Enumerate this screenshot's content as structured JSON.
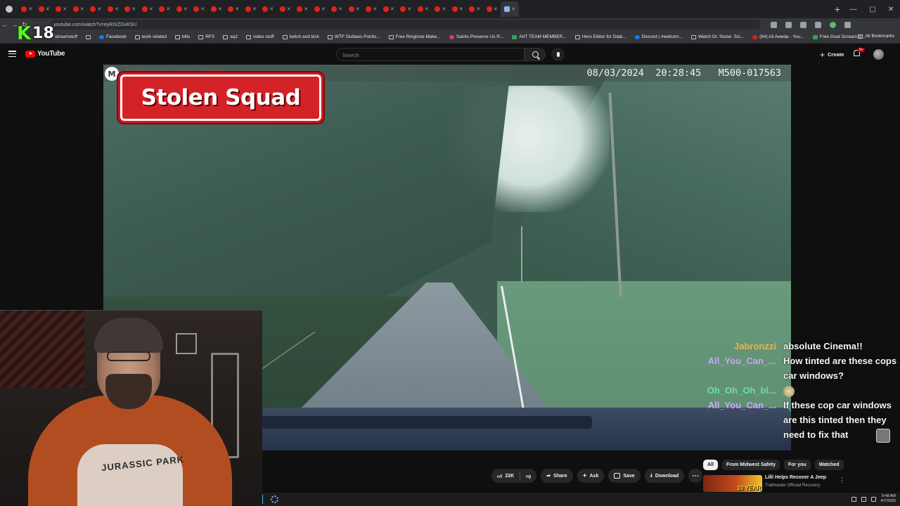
{
  "overlay": {
    "k_logo": "K",
    "k_count": "18"
  },
  "browser": {
    "tab_count": 29,
    "address": "youtube.com/watch?v=eyRIXZGvKSU",
    "bookmarks": [
      {
        "label": "Facebook",
        "icon": "facebook-icon"
      },
      {
        "label": "work related",
        "icon": "folder-icon"
      },
      {
        "label": "bills",
        "icon": "folder-icon"
      },
      {
        "label": "RFS",
        "icon": "folder-icon"
      },
      {
        "label": "eq2",
        "icon": "folder-icon"
      },
      {
        "label": "video stuff",
        "icon": "folder-icon"
      },
      {
        "label": "twitch and kick",
        "icon": "folder-icon"
      },
      {
        "label": "WTF Outlaws Points...",
        "icon": "folder-icon"
      },
      {
        "label": "Free Ringtone Make...",
        "icon": "page-icon"
      },
      {
        "label": "Saints Preserve Us R...",
        "icon": "pink-icon"
      },
      {
        "label": "AIIT TEAM MEMBER...",
        "icon": "green-icon"
      },
      {
        "label": "Hero Editor for Diab...",
        "icon": "page-icon"
      },
      {
        "label": "Discord | #welcom...",
        "icon": "discord-icon"
      },
      {
        "label": "Watch Dr. Stone: Sci...",
        "icon": "globe-icon"
      },
      {
        "label": "(84) Ali Aweda - You...",
        "icon": "youtube-icon"
      },
      {
        "label": "Free Goat Scream S...",
        "icon": "green-icon"
      }
    ],
    "all_bookmarks": "All Bookmarks",
    "partial_bookmark": "streamstuff"
  },
  "youtube": {
    "logo_text": "YouTube",
    "search_placeholder": "Search",
    "create_label": "Create",
    "notification_badge": "9+"
  },
  "video": {
    "watermark": "MOTOROLA SOLUTIONS",
    "timestamp": "08/03/2024  20:28:45   M500-017563",
    "title_overlay": "Stolen Squad"
  },
  "webcam": {
    "shirt_text": "JURASSIC PARK"
  },
  "chat": [
    {
      "user": "Jabronzzi",
      "color": "#e8b450",
      "text": "absolute Cinema!!"
    },
    {
      "user": "All_You_Can_...",
      "color": "#c9a5ff",
      "text": "How tinted are these cops car windows?"
    },
    {
      "user": "Oh_Oh_Oh_bl...",
      "color": "#6be0a0",
      "text": "",
      "emote": true
    },
    {
      "user": "All_You_Can_...",
      "color": "#c9a5ff",
      "text": "If these cop car windows are this tinted then they need to fix that"
    }
  ],
  "actions": {
    "like_count": "22K",
    "share": "Share",
    "ask": "Ask",
    "save": "Save",
    "download": "Download"
  },
  "chips": [
    "All",
    "From Midwest Safety",
    "For you",
    "Watched"
  ],
  "recommendation": {
    "title": "Lilli Helps Recover A Jeep",
    "channel": "Trailmaster Offroad Recovery",
    "thumb_text": "10 YEAR"
  },
  "taskbar": {
    "time": "9:48 AM",
    "date": "4/7/2026"
  }
}
